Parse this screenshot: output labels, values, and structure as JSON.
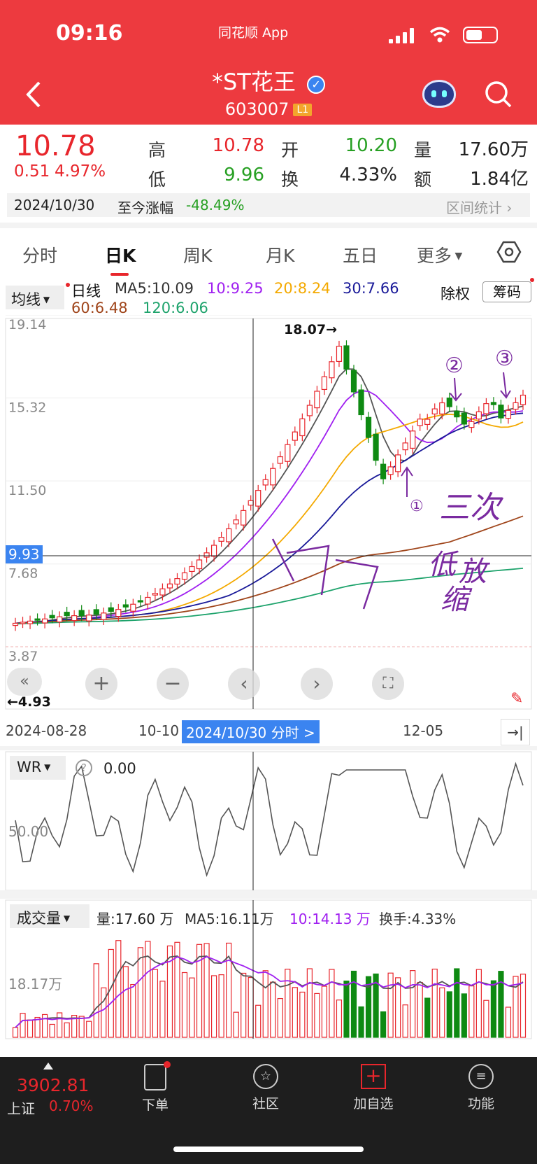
{
  "status": {
    "time": "09:16",
    "app": "同花顺 App"
  },
  "header": {
    "title": "*ST花王",
    "code": "603007",
    "level": "L1"
  },
  "quote": {
    "price": "10.78",
    "change": "0.51",
    "change_pct": "4.97%",
    "high_label": "高",
    "high": "10.78",
    "low_label": "低",
    "low": "9.96",
    "open_label": "开",
    "open": "10.20",
    "turnover_label": "换",
    "turnover": "4.33%",
    "volume_label": "量",
    "volume": "17.60万",
    "amount_label": "额",
    "amount": "1.84亿",
    "date": "2024/10/30",
    "range_label": "至今涨幅",
    "range_pct": "-48.49%",
    "interval_label": "区间统计"
  },
  "tabs": [
    "分时",
    "日K",
    "周K",
    "月K",
    "五日",
    "更多"
  ],
  "indicators": {
    "ma_dropdown": "均线",
    "period": "日线",
    "ma5": "MA5:10.09",
    "ma10": "10:9.25",
    "ma20": "20:8.24",
    "ma30": "30:7.66",
    "ma60": "60:6.48",
    "ma120": "120:6.06",
    "adjust": "除权",
    "chips": "筹码"
  },
  "colors": {
    "up": "#e8262c",
    "down": "#0e8a12",
    "ma5": "#555555",
    "ma10": "#a020f0",
    "ma20": "#f4a900",
    "ma30": "#1a1a99",
    "ma60": "#a0461c",
    "ma120": "#1ea36c",
    "wr": "#555555",
    "annotation": "#7a2aa0"
  },
  "kline": {
    "y_ticks": [
      "19.14",
      "15.32",
      "11.50",
      "7.68",
      "3.87"
    ],
    "cursor_price": "9.93",
    "max_label": "18.07→",
    "min_label": "←4.93",
    "x_labels": [
      "2024-08-28",
      "10-10",
      "12-05"
    ],
    "cursor_date": "2024/10/30 分时 >",
    "annotations": [
      "②",
      "③",
      "①",
      "三次",
      "低",
      "放",
      "缩"
    ]
  },
  "wr": {
    "name": "WR",
    "value": "0.00",
    "tick": "50.00"
  },
  "volume": {
    "name": "成交量",
    "vol": "量:17.60 万",
    "ma5": "MA5:16.11万",
    "ma10": "10:14.13 万",
    "turnover": "换手:4.33%",
    "tick": "18.17万"
  },
  "bottom_nav": {
    "index_value": "3902.81",
    "index_name": "上证",
    "index_pct": "0.70%",
    "items": [
      "下单",
      "社区",
      "加自选",
      "功能"
    ]
  }
}
